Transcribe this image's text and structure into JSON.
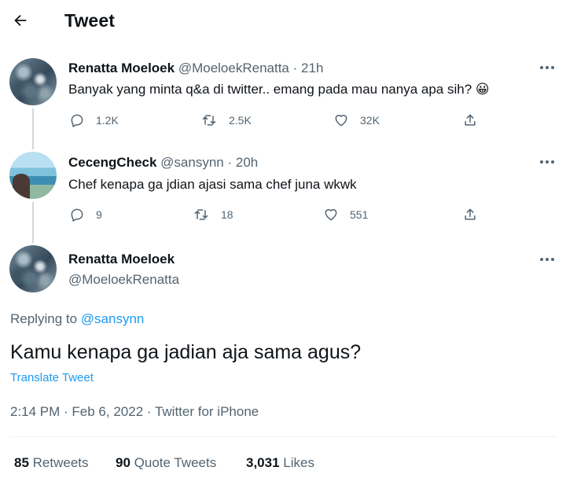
{
  "header": {
    "title": "Tweet",
    "back_icon": "back-arrow-icon"
  },
  "thread": [
    {
      "author_name": "Renatta Moeloek",
      "author_handle": "@MoeloekRenatta",
      "separator": "·",
      "time": "21h",
      "text": "Banyak yang minta q&a di twitter.. emang pada mau nanya apa sih?",
      "emoji": "😀",
      "replies": "1.2K",
      "retweets": "2.5K",
      "likes": "32K"
    },
    {
      "author_name": "CecengCheck",
      "author_handle": "@sansynn",
      "separator": "·",
      "time": "20h",
      "text": "Chef kenapa ga jdian ajasi sama chef juna wkwk",
      "replies": "9",
      "retweets": "18",
      "likes": "551"
    }
  ],
  "main_tweet": {
    "author_name": "Renatta Moeloek",
    "author_handle": "@MoeloekRenatta",
    "replying_label": "Replying to",
    "replying_handle": "@sansynn",
    "text": "Kamu kenapa ga jadian aja sama agus?",
    "translate_label": "Translate Tweet",
    "timestamp": "2:14 PM · Feb 6, 2022 · Twitter for iPhone",
    "stats": {
      "retweets_count": "85",
      "retweets_label": "Retweets",
      "quotes_count": "90",
      "quotes_label": "Quote Tweets",
      "likes_count": "3,031",
      "likes_label": "Likes"
    }
  },
  "colors": {
    "accent": "#1d9bf0",
    "secondary_text": "#536471",
    "primary_text": "#0f1419",
    "thread_line": "#cfd9de"
  }
}
